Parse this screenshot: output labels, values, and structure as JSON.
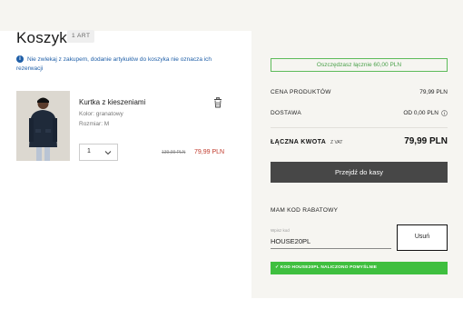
{
  "cart": {
    "title": "Koszyk",
    "count": "1 ART",
    "notice": "Nie zwlekaj z zakupem, dodanie artykułów do koszyka nie oznacza ich rezerwacji",
    "item": {
      "name": "Kurtka z kieszeniami",
      "color": "Kolor: granatowy",
      "size": "Rozmiar: M",
      "quantity": "1",
      "old_price": "139,99 PLN",
      "price": "79,99 PLN"
    }
  },
  "summary": {
    "savings": "Oszczędzasz łącznie 60,00 PLN",
    "products_label": "CENA PRODUKTÓW",
    "products_value": "79,99 PLN",
    "shipping_label": "DOSTAWA",
    "shipping_value": "OD 0,00 PLN",
    "total_label": "ŁĄCZNA KWOTA",
    "total_vat": "Z VAT",
    "total_value": "79,99 PLN",
    "checkout_label": "Przejdź do kasy",
    "discount_label": "MAM KOD RABATOWY",
    "code_placeholder": "Wpisz kod",
    "code_value": "HOUSE20PL",
    "apply_label": "Usuń",
    "success_message": "✓ KOD HOUSE20PL NALICZONO POMYŚLNIE"
  },
  "colors": {
    "accent_blue": "#1f5fa8",
    "sale_red": "#c0392b",
    "success_green": "#3fbf3f",
    "checkout_dark": "#474747"
  },
  "icons": {
    "info": "info-icon",
    "trash": "trash-icon",
    "chevron": "chevron-down-icon",
    "shipping_info": "info-circle-icon"
  }
}
